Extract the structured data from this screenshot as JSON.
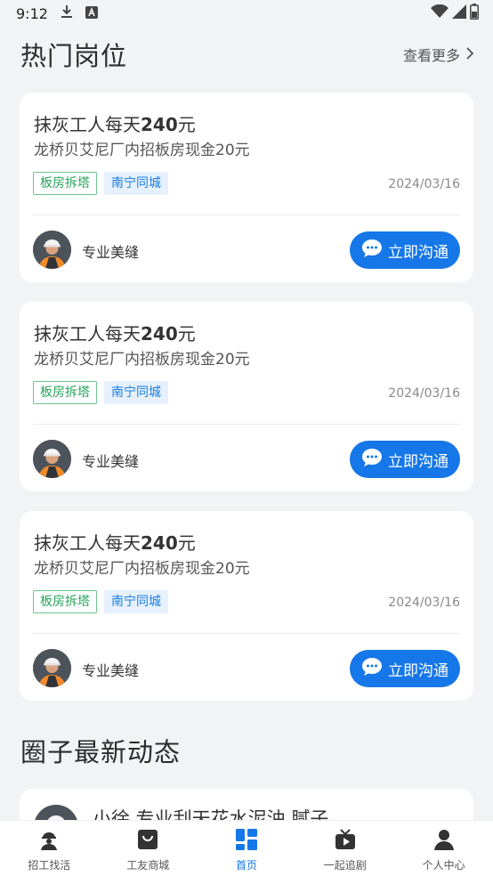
{
  "status_bar": {
    "time": "9:12"
  },
  "hot_jobs": {
    "title": "热门岗位",
    "more_label": "查看更多",
    "cards": [
      {
        "title_prefix": "抹灰工人每天",
        "title_amount": "240",
        "title_suffix": "元",
        "subtitle": "龙桥贝艾尼厂内招板房现金20元",
        "tags": [
          "板房拆塔",
          "南宁同城"
        ],
        "date": "2024/03/16",
        "poster": "专业美缝",
        "chat_label": "立即沟通"
      },
      {
        "title_prefix": "抹灰工人每天",
        "title_amount": "240",
        "title_suffix": "元",
        "subtitle": "龙桥贝艾尼厂内招板房现金20元",
        "tags": [
          "板房拆塔",
          "南宁同城"
        ],
        "date": "2024/03/16",
        "poster": "专业美缝",
        "chat_label": "立即沟通"
      },
      {
        "title_prefix": "抹灰工人每天",
        "title_amount": "240",
        "title_suffix": "元",
        "subtitle": "龙桥贝艾尼厂内招板房现金20元",
        "tags": [
          "板房拆塔",
          "南宁同城"
        ],
        "date": "2024/03/16",
        "poster": "专业美缝",
        "chat_label": "立即沟通"
      }
    ]
  },
  "circle": {
    "title": "圈子最新动态",
    "post_text": "小徐 专业刮天花水泥油 腻子"
  },
  "bottom_nav": {
    "items": [
      {
        "label": "招工找活",
        "icon": "worker-icon"
      },
      {
        "label": "工友商城",
        "icon": "shop-icon"
      },
      {
        "label": "首页",
        "icon": "home-grid-icon"
      },
      {
        "label": "一起追剧",
        "icon": "tv-icon"
      },
      {
        "label": "个人中心",
        "icon": "user-icon"
      }
    ],
    "active_index": 2
  },
  "colors": {
    "accent": "#1677e8",
    "tag_green": "#27a35a",
    "tag_blue": "#1c7fe0",
    "background": "#f2f3f5"
  }
}
